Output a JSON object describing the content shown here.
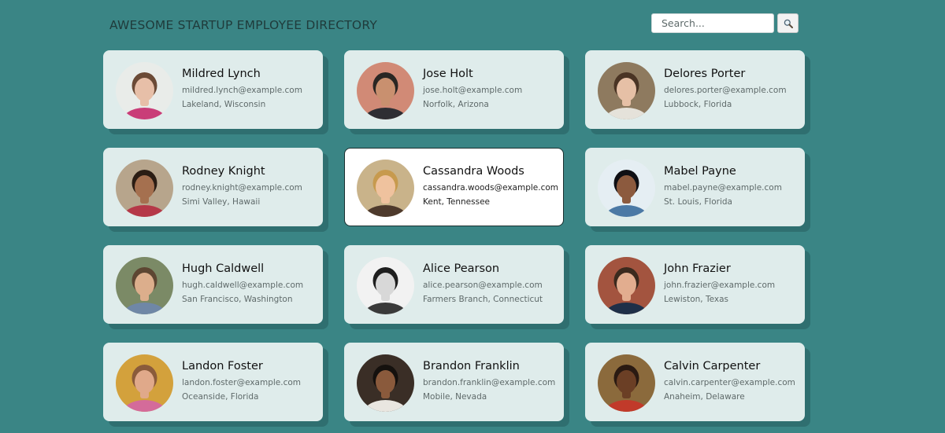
{
  "header": {
    "title": "AWESOME STARTUP EMPLOYEE DIRECTORY",
    "search_placeholder": "Search...",
    "search_value": "",
    "search_button_icon": "magnifier-icon"
  },
  "colors": {
    "page_background": "#3a8585",
    "card_background": "#dfeceb",
    "card_shadow": "#2f6f70",
    "active_card_background": "#ffffff"
  },
  "employees": [
    {
      "name": "Mildred Lynch",
      "email": "mildred.lynch@example.com",
      "location": "Lakeland, Wisconsin",
      "active": false,
      "avatar": {
        "bg": "#e9ece9",
        "skin": "#e7bfa8",
        "hair": "#6b4a36",
        "shirt": "#c93d78"
      }
    },
    {
      "name": "Jose Holt",
      "email": "jose.holt@example.com",
      "location": "Norfolk, Arizona",
      "active": false,
      "avatar": {
        "bg": "#d18a76",
        "skin": "#c9906f",
        "hair": "#2a2623",
        "shirt": "#2e2e33"
      }
    },
    {
      "name": "Delores Porter",
      "email": "delores.porter@example.com",
      "location": "Lubbock, Florida",
      "active": false,
      "avatar": {
        "bg": "#8e7a5f",
        "skin": "#e6c0a6",
        "hair": "#4a3424",
        "shirt": "#e5e2da"
      }
    },
    {
      "name": "Rodney Knight",
      "email": "rodney.knight@example.com",
      "location": "Simi Valley, Hawaii",
      "active": false,
      "avatar": {
        "bg": "#b7a58c",
        "skin": "#a5704f",
        "hair": "#2b1d14",
        "shirt": "#b53848"
      }
    },
    {
      "name": "Cassandra Woods",
      "email": "cassandra.woods@example.com",
      "location": "Kent, Tennessee",
      "active": true,
      "avatar": {
        "bg": "#c9b38a",
        "skin": "#efc29e",
        "hair": "#c79a4e",
        "shirt": "#4e3a2c"
      }
    },
    {
      "name": "Mabel Payne",
      "email": "mabel.payne@example.com",
      "location": "St. Louis, Florida",
      "active": false,
      "avatar": {
        "bg": "#e5eef3",
        "skin": "#8c5a3e",
        "hair": "#0f0f14",
        "shirt": "#4b79a5"
      }
    },
    {
      "name": "Hugh Caldwell",
      "email": "hugh.caldwell@example.com",
      "location": "San Francisco, Washington",
      "active": false,
      "avatar": {
        "bg": "#7b8a66",
        "skin": "#dcae8c",
        "hair": "#5d4632",
        "shirt": "#6f87a6"
      }
    },
    {
      "name": "Alice Pearson",
      "email": "alice.pearson@example.com",
      "location": "Farmers Branch, Connecticut",
      "active": false,
      "avatar": {
        "bg": "#f2f2f2",
        "skin": "#d8d8d8",
        "hair": "#1e1e1e",
        "shirt": "#3a3a3a"
      }
    },
    {
      "name": "John Frazier",
      "email": "john.frazier@example.com",
      "location": "Lewiston, Texas",
      "active": false,
      "avatar": {
        "bg": "#a3543f",
        "skin": "#e2ad8f",
        "hair": "#3b2a1e",
        "shirt": "#1e2f48"
      }
    },
    {
      "name": "Landon Foster",
      "email": "landon.foster@example.com",
      "location": "Oceanside, Florida",
      "active": false,
      "avatar": {
        "bg": "#d3a13c",
        "skin": "#e0a98a",
        "hair": "#8a5b3b",
        "shirt": "#d46b9a"
      }
    },
    {
      "name": "Brandon Franklin",
      "email": "brandon.franklin@example.com",
      "location": "Mobile, Nevada",
      "active": false,
      "avatar": {
        "bg": "#3a2e26",
        "skin": "#8a5a3c",
        "hair": "#15110e",
        "shirt": "#e9e6e0"
      }
    },
    {
      "name": "Calvin Carpenter",
      "email": "calvin.carpenter@example.com",
      "location": "Anaheim, Delaware",
      "active": false,
      "avatar": {
        "bg": "#8b6a3c",
        "skin": "#6b3f25",
        "hair": "#2a1a12",
        "shirt": "#c13a2a"
      }
    }
  ]
}
